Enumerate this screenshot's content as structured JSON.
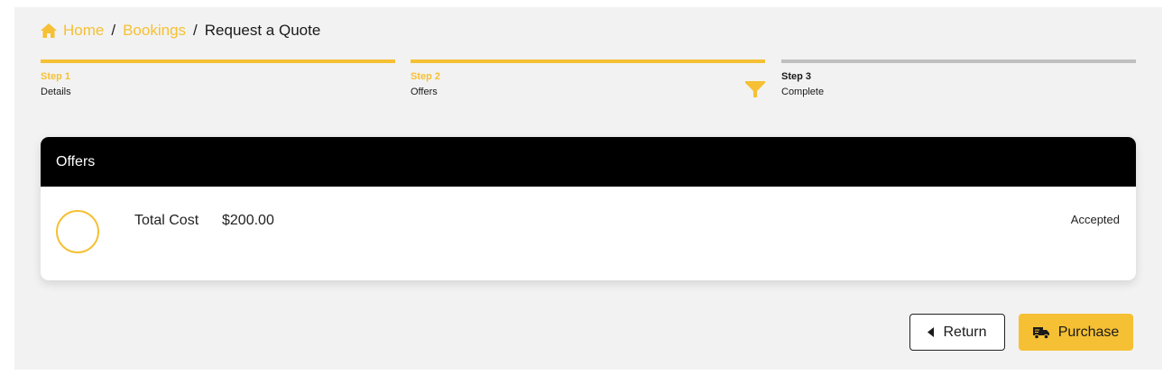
{
  "breadcrumb": {
    "home_icon": "home-icon",
    "home": "Home",
    "separator": "/",
    "bookings": "Bookings",
    "current": "Request a Quote"
  },
  "steps": [
    {
      "number": "Step 1",
      "name": "Details",
      "state": "done",
      "color": "#f5c034"
    },
    {
      "number": "Step 2",
      "name": "Offers",
      "state": "active",
      "color": "#f5c034"
    },
    {
      "number": "Step 3",
      "name": "Complete",
      "state": "pending",
      "color": "#bfbfbf"
    }
  ],
  "step_marker_icon": "filter-icon",
  "offers": {
    "title": "Offers",
    "items": [
      {
        "label": "Total Cost",
        "value": "$200.00",
        "status": "Accepted"
      }
    ]
  },
  "actions": {
    "return_label": "Return",
    "return_icon": "caret-left-icon",
    "purchase_label": "Purchase",
    "purchase_icon": "truck-icon"
  },
  "colors": {
    "accent": "#f5c034",
    "header_bg": "#000000",
    "page_bg": "#f2f2f2",
    "inactive": "#bfbfbf"
  }
}
